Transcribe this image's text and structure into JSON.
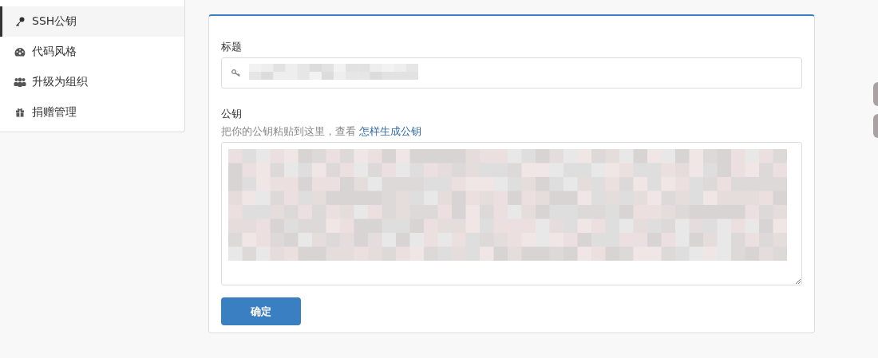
{
  "sidebar": {
    "items": [
      {
        "label": "SSH公钥",
        "kind": "key",
        "selected": true
      },
      {
        "label": "代码风格",
        "kind": "gauge",
        "selected": false
      },
      {
        "label": "升级为组织",
        "kind": "users",
        "selected": false
      },
      {
        "label": "捐赠管理",
        "kind": "gift",
        "selected": false
      }
    ]
  },
  "form": {
    "title_field": {
      "label": "标题",
      "redacted": true
    },
    "key_field": {
      "label": "公钥",
      "help": "把你的公钥粘贴到这里，查看",
      "help_link": "怎样生成公钥",
      "redacted": true
    },
    "submit": "确定"
  }
}
